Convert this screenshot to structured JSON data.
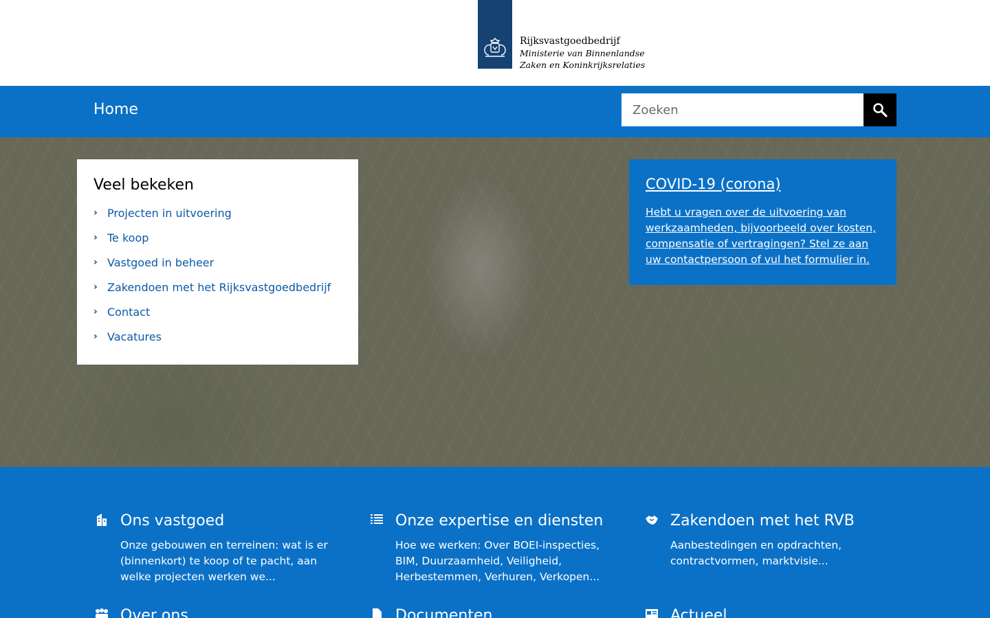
{
  "header": {
    "org_name": "Rijksvastgoedbedrijf",
    "ministry": "Ministerie van Binnenlandse Zaken en Koninkrijksrelaties"
  },
  "nav": {
    "home": "Home",
    "search_placeholder": "Zoeken"
  },
  "popular": {
    "title": "Veel bekeken",
    "items": [
      {
        "label": "Projecten in uitvoering"
      },
      {
        "label": "Te koop"
      },
      {
        "label": "Vastgoed in beheer"
      },
      {
        "label": "Zakendoen met het Rijksvastgoedbedrijf"
      },
      {
        "label": "Contact"
      },
      {
        "label": "Vacatures"
      }
    ]
  },
  "covid": {
    "title": "COVID-19 (corona)",
    "text": "Hebt u vragen over de uitvoering van werkzaamheden, bijvoorbeeld over kosten, compensatie of vertragingen? Stel ze aan uw contactpersoon of vul het formulier in."
  },
  "sections": [
    {
      "icon": "building-icon",
      "title": "Ons vastgoed",
      "text": "Onze gebouwen en terreinen: wat is er (binnenkort) te koop of te pacht, aan welke projecten werken we..."
    },
    {
      "icon": "list-icon",
      "title": "Onze expertise en diensten",
      "text": "Hoe we werken: Over BOEI-inspecties, BIM, Duurzaamheid, Veiligheid, Herbestemmen, Verhuren, Verkopen..."
    },
    {
      "icon": "handshake-icon",
      "title": "Zakendoen met het RVB",
      "text": "Aanbestedingen en opdrachten, contractvormen, marktvisie..."
    },
    {
      "icon": "people-icon",
      "title": "Over ons",
      "text": ""
    },
    {
      "icon": "document-icon",
      "title": "Documenten",
      "text": ""
    },
    {
      "icon": "newspaper-icon",
      "title": "Actueel",
      "text": ""
    }
  ],
  "colors": {
    "primary_blue": "#0b71c7",
    "logo_blue": "#154273",
    "link_blue": "#0b5aa8"
  }
}
